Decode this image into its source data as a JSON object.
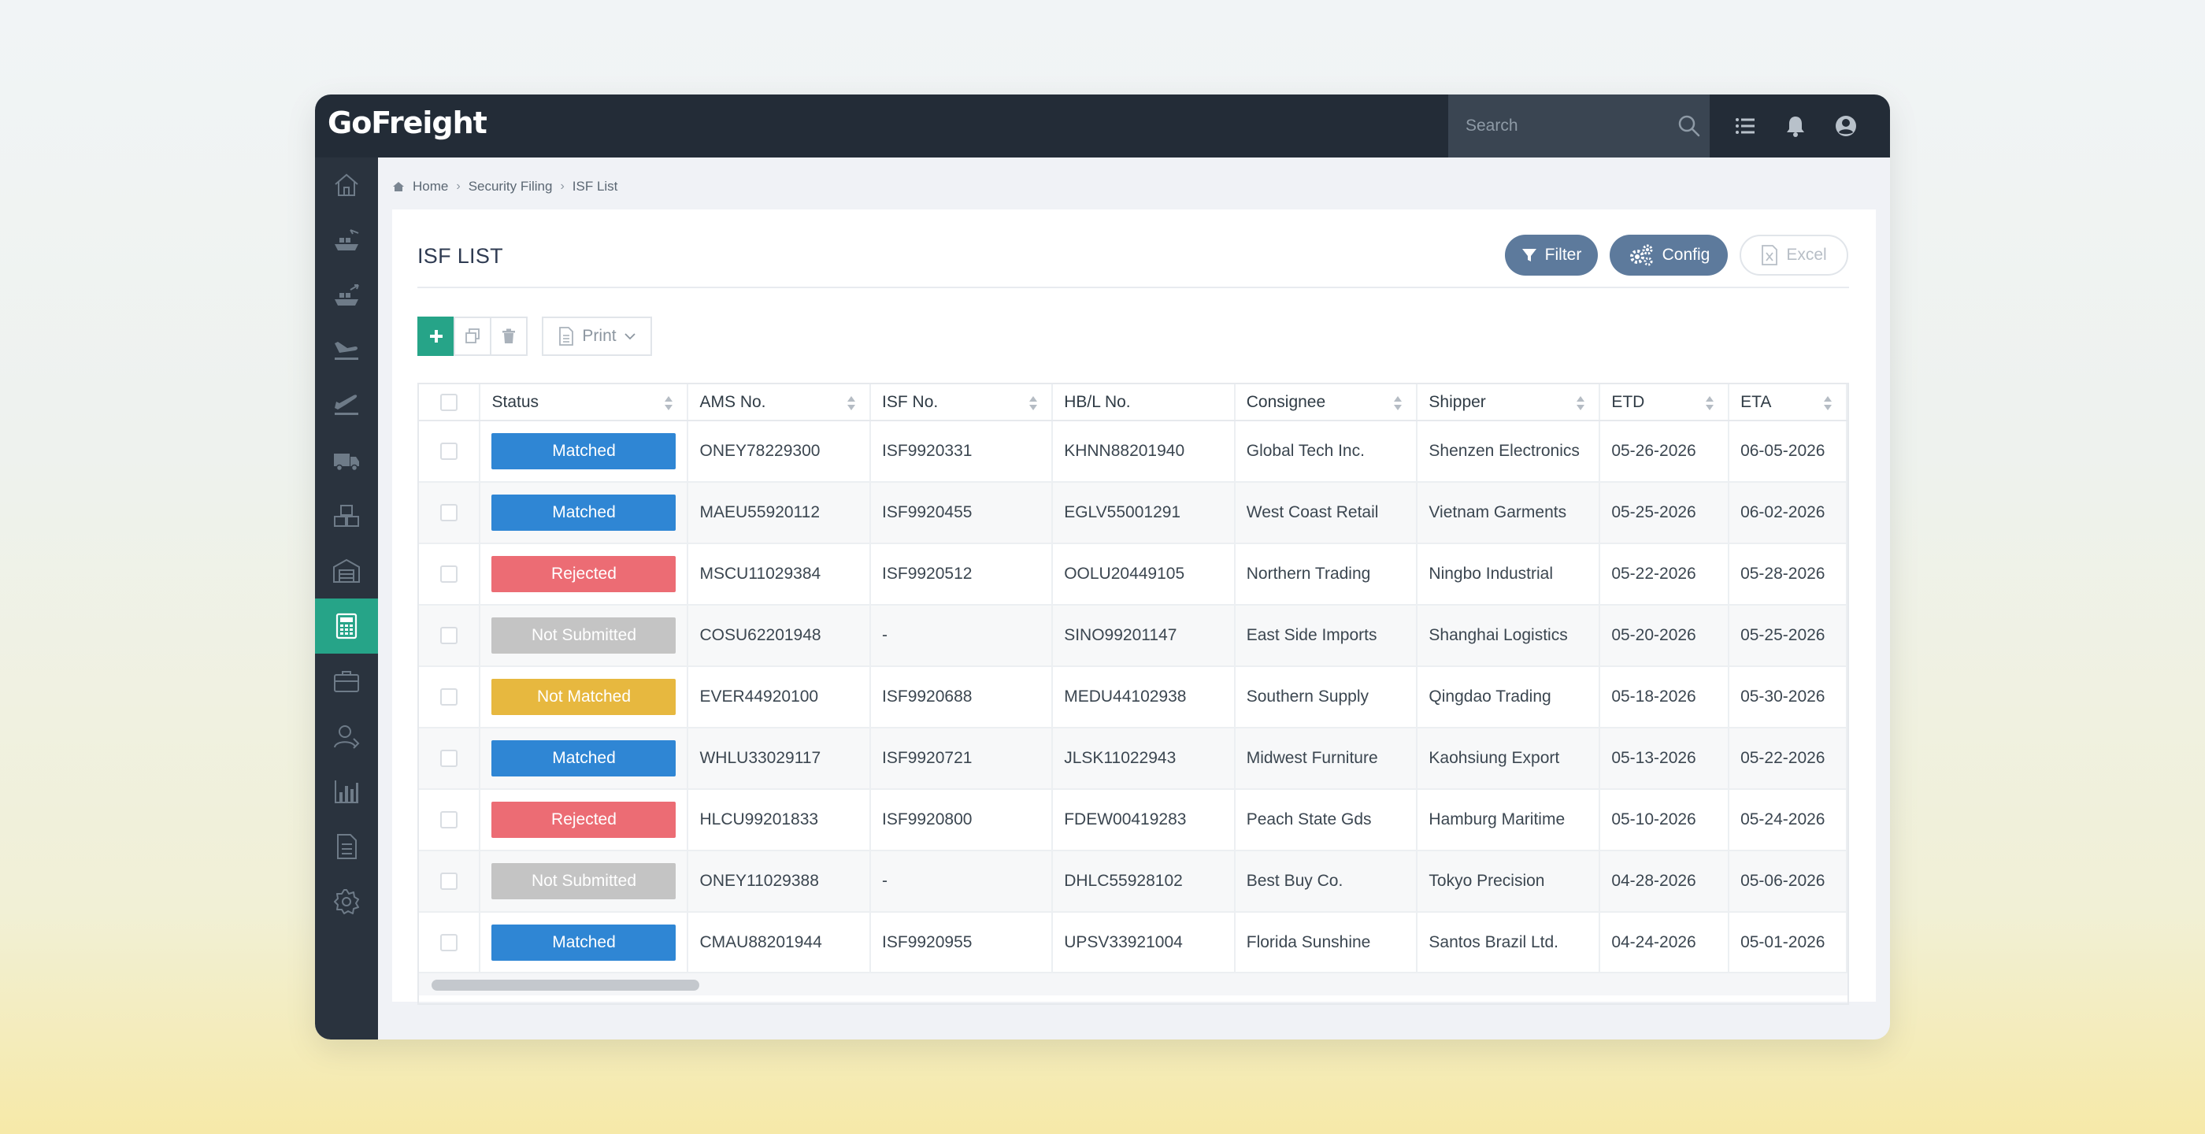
{
  "app": {
    "logo": "GoFreight"
  },
  "search": {
    "placeholder": "Search"
  },
  "breadcrumb": {
    "items": [
      "Home",
      "Security Filing",
      "ISF List"
    ]
  },
  "page": {
    "title": "ISF LIST"
  },
  "actions": {
    "filter": "Filter",
    "config": "Config",
    "excel": "Excel",
    "print": "Print"
  },
  "sidebar": {
    "icons": [
      "home-icon",
      "ocean-import-icon",
      "ocean-export-icon",
      "air-import-icon",
      "air-export-icon",
      "truck-icon",
      "warehouse-boxes-icon",
      "warehouse-icon",
      "accounting-calculator-icon",
      "briefcase-icon",
      "contacts-icon",
      "reports-chart-icon",
      "documents-icon",
      "settings-gear-icon"
    ],
    "active_index": 8
  },
  "table": {
    "columns": [
      "Status",
      "AMS No.",
      "ISF No.",
      "HB/L No.",
      "Consignee",
      "Shipper",
      "ETD",
      "ETA"
    ],
    "rows": [
      {
        "status": "Matched",
        "status_color": "#2f86d4",
        "ams": "ONEY78229300",
        "isf": "ISF9920331",
        "hbl": "KHNN88201940",
        "consignee": "Global Tech Inc.",
        "shipper": "Shenzen Electronics",
        "etd": "05-26-2026",
        "eta": "06-05-2026"
      },
      {
        "status": "Matched",
        "status_color": "#2f86d4",
        "ams": "MAEU55920112",
        "isf": "ISF9920455",
        "hbl": "EGLV55001291",
        "consignee": "West Coast Retail",
        "shipper": "Vietnam Garments",
        "etd": "05-25-2026",
        "eta": "06-02-2026"
      },
      {
        "status": "Rejected",
        "status_color": "#ec6c74",
        "ams": "MSCU11029384",
        "isf": "ISF9920512",
        "hbl": "OOLU20449105",
        "consignee": "Northern Trading",
        "shipper": "Ningbo Industrial",
        "etd": "05-22-2026",
        "eta": "05-28-2026"
      },
      {
        "status": "Not Submitted",
        "status_color": "#c4c4c4",
        "ams": "COSU62201948",
        "isf": "-",
        "hbl": "SINO99201147",
        "consignee": "East Side Imports",
        "shipper": "Shanghai Logistics",
        "etd": "05-20-2026",
        "eta": "05-25-2026"
      },
      {
        "status": "Not Matched",
        "status_color": "#e7b83f",
        "ams": "EVER44920100",
        "isf": "ISF9920688",
        "hbl": "MEDU44102938",
        "consignee": "Southern Supply",
        "shipper": "Qingdao Trading",
        "etd": "05-18-2026",
        "eta": "05-30-2026"
      },
      {
        "status": "Matched",
        "status_color": "#2f86d4",
        "ams": "WHLU33029117",
        "isf": "ISF9920721",
        "hbl": "JLSK11022943",
        "consignee": "Midwest Furniture",
        "shipper": "Kaohsiung Export",
        "etd": "05-13-2026",
        "eta": "05-22-2026"
      },
      {
        "status": "Rejected",
        "status_color": "#ec6c74",
        "ams": "HLCU99201833",
        "isf": "ISF9920800",
        "hbl": "FDEW00419283",
        "consignee": "Peach State Gds",
        "shipper": "Hamburg Maritime",
        "etd": "05-10-2026",
        "eta": "05-24-2026"
      },
      {
        "status": "Not Submitted",
        "status_color": "#c4c4c4",
        "ams": "ONEY11029388",
        "isf": "-",
        "hbl": "DHLC55928102",
        "consignee": "Best Buy Co.",
        "shipper": "Tokyo Precision",
        "etd": "04-28-2026",
        "eta": "05-06-2026"
      },
      {
        "status": "Matched",
        "status_color": "#2f86d4",
        "ams": "CMAU88201944",
        "isf": "ISF9920955",
        "hbl": "UPSV33921004",
        "consignee": "Florida Sunshine",
        "shipper": "Santos Brazil Ltd.",
        "etd": "04-24-2026",
        "eta": "05-01-2026"
      }
    ]
  }
}
